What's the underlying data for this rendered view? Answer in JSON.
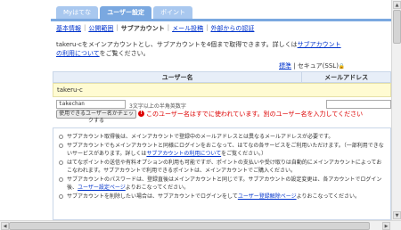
{
  "tabs": [
    {
      "label": "Myはてな"
    },
    {
      "label": "ユーザー設定"
    },
    {
      "label": "ポイント"
    }
  ],
  "subnav": {
    "items": [
      "基本情報",
      "公開範囲",
      "サブアカウント",
      "メール投稿",
      "外部からの認証"
    ],
    "sep": "|"
  },
  "description": {
    "text_before": "takeru-cをメインアカウントとし、サブアカウントを4個まで取得できます。詳しくは",
    "link": "サブアカウントの利用について",
    "text_after": "をご覧ください。"
  },
  "security": {
    "standard_label": "標準",
    "sep": " | ",
    "ssl_label": "セキュア(SSL)",
    "marker": "🔒"
  },
  "table": {
    "header_username": "ユーザー名",
    "header_email": "メールアドレス",
    "main_user": "takeru-c"
  },
  "form": {
    "username_value": "takechan",
    "username_hint": "3文字以上の半角英数字",
    "check_button_label": "使用できるユーザー名かチェックする",
    "error_message": "このユーザー名はすでに使われています。別のユーザー名を入力してください"
  },
  "notes": [
    {
      "text": "サブアカウント取得後は、メインアカウントで登録中のメールアドレスとは異なるメールアドレスが必要です。"
    },
    {
      "text": "サブアカウントでもメインアカウントと同様にログインをおこなって、はてなの各サービスをご利用いただけます。（一部利用できないサービスがあります。詳しくは",
      "link": "サブアカウントの利用について",
      "after": "をご覧ください。）"
    },
    {
      "text": "はてなポイントの送信や有料オプションの利用も可能ですが、ポイントの支払いや受け取りは自動的にメインアカウントによっておこなわれます。サブアカウントで利用できるポイントは、メインアカウントでご購入ください。"
    },
    {
      "text": "サブアカウントのパスワードは、登録直後はメインアカウントと同じです。サブアカウントの設定変更は、各アカウントでログイン後、",
      "link": "ユーザー設定ページ",
      "after": "よりおこなってください。"
    },
    {
      "text": "サブアカウントを削除したい場合は、サブアカウントでログインをして",
      "link": "ユーザー登録解除ページ",
      "after": "よりおこなってください。"
    }
  ],
  "scrollbars": {
    "up": "▲",
    "down": "▼",
    "left": "◀",
    "right": "▶"
  },
  "error_glyph": "!"
}
